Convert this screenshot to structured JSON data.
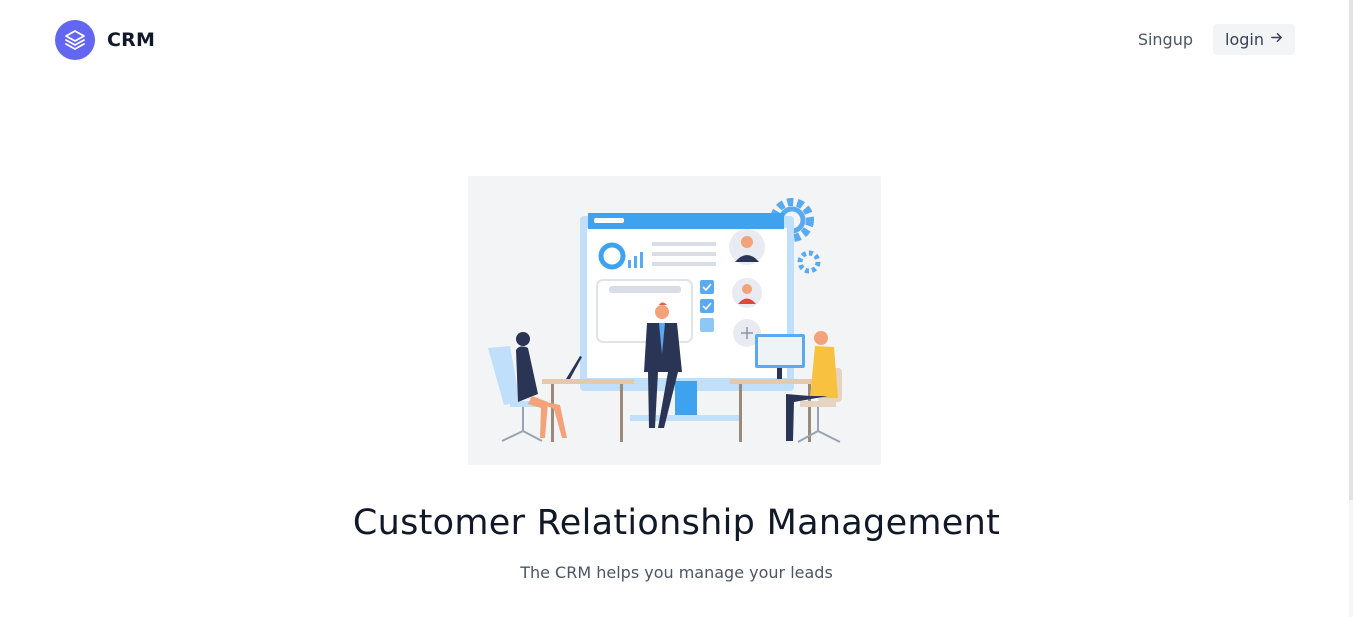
{
  "brand": {
    "name": "CRM",
    "logo_icon": "layers-icon",
    "logo_color": "#6366f1"
  },
  "nav": {
    "signup_label": "Singup",
    "login_label": "login",
    "login_icon": "arrow-right-icon"
  },
  "hero": {
    "title": "Customer Relationship Management",
    "subtitle": "The CRM helps you manage your leads",
    "illustration": "crm-team-illustration"
  }
}
